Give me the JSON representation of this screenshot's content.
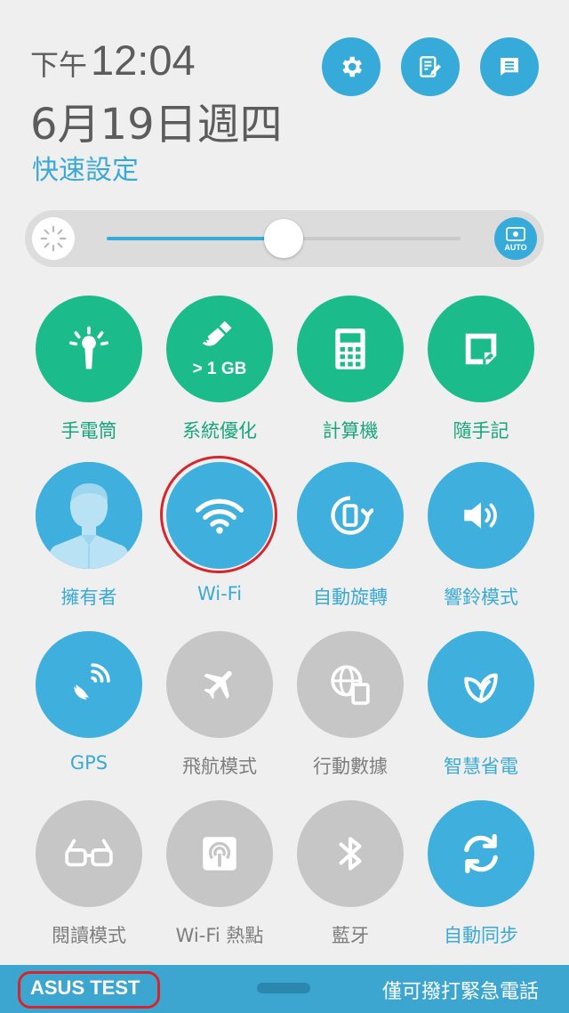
{
  "header": {
    "ampm": "下午",
    "time": "12:04",
    "date": "6月19日週四",
    "title": "快速設定",
    "buttons": [
      {
        "name": "settings-button",
        "icon": "gear-icon"
      },
      {
        "name": "edit-button",
        "icon": "edit-list-icon"
      },
      {
        "name": "notification-list-button",
        "icon": "message-list-icon"
      }
    ]
  },
  "brightness": {
    "level_percent": 50,
    "auto_label": "AUTO"
  },
  "tiles": [
    {
      "label": "手電筒",
      "icon": "flashlight-icon",
      "state": "active",
      "color": "#1cbb8c"
    },
    {
      "label": "系統優化",
      "sub_label": "> 1 GB",
      "icon": "broom-icon",
      "state": "active",
      "color": "#1cbb8c"
    },
    {
      "label": "計算機",
      "icon": "calculator-icon",
      "state": "active",
      "color": "#1cbb8c"
    },
    {
      "label": "隨手記",
      "icon": "note-icon",
      "state": "active",
      "color": "#1cbb8c"
    },
    {
      "label": "擁有者",
      "icon": "person-avatar-icon",
      "state": "active",
      "color": "#3fb0de"
    },
    {
      "label": "Wi-Fi",
      "icon": "wifi-icon",
      "state": "on",
      "color": "#3fb0de"
    },
    {
      "label": "自動旋轉",
      "icon": "auto-rotate-icon",
      "state": "on",
      "color": "#3fb0de"
    },
    {
      "label": "響鈴模式",
      "icon": "speaker-icon",
      "state": "on",
      "color": "#3fb0de"
    },
    {
      "label": "GPS",
      "icon": "satellite-icon",
      "state": "on",
      "color": "#3fb0de"
    },
    {
      "label": "飛航模式",
      "icon": "airplane-icon",
      "state": "off",
      "color": "#c6c6c6"
    },
    {
      "label": "行動數據",
      "icon": "mobile-data-icon",
      "state": "off",
      "color": "#c6c6c6"
    },
    {
      "label": "智慧省電",
      "icon": "leaf-icon",
      "state": "on",
      "color": "#3fb0de"
    },
    {
      "label": "閱讀模式",
      "icon": "glasses-icon",
      "state": "off",
      "color": "#c6c6c6"
    },
    {
      "label": "Wi-Fi 熱點",
      "icon": "hotspot-icon",
      "state": "off",
      "color": "#c6c6c6"
    },
    {
      "label": "藍牙",
      "icon": "bluetooth-icon",
      "state": "off",
      "color": "#c6c6c6"
    },
    {
      "label": "自動同步",
      "icon": "sync-icon",
      "state": "on",
      "color": "#3fb0de"
    }
  ],
  "bottom_bar": {
    "carrier": "ASUS TEST",
    "emergency": "僅可撥打緊急電話"
  }
}
